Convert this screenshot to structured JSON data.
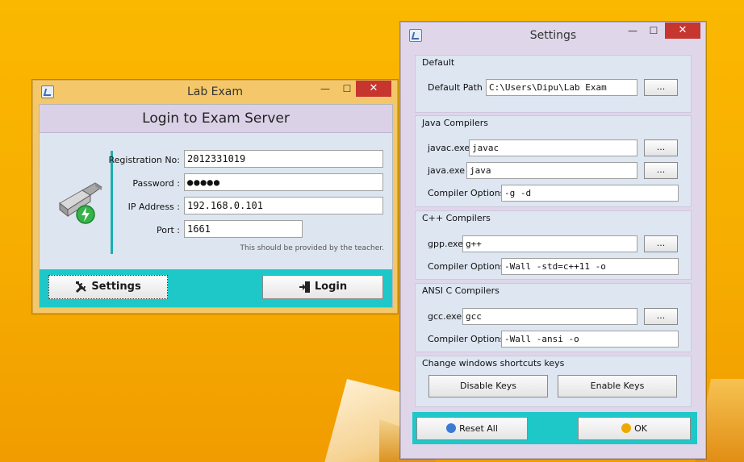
{
  "lab_window": {
    "title": "Lab Exam",
    "header": "Login to Exam Server",
    "fields": {
      "registration_label": "Registration No:",
      "registration_value": "2012331019",
      "password_label": "Password :",
      "password_value": "●●●●●",
      "ip_label": "IP Address :",
      "ip_value": "192.168.0.101",
      "port_label": "Port :",
      "port_value": "1661"
    },
    "hint": "This should be provided by the teacher.",
    "settings_label": "Settings",
    "login_label": "Login",
    "minimize": "—",
    "maximize": "☐",
    "close": "✕"
  },
  "settings_window": {
    "title": "Settings",
    "minimize": "—",
    "maximize": "☐",
    "close": "✕",
    "default": {
      "title": "Default",
      "path_label": "Default Path :",
      "path_value": "C:\\Users\\Dipu\\Lab Exam",
      "browse": "..."
    },
    "java": {
      "title": "Java Compilers",
      "javac_label": "javac.exe",
      "javac_value": "javac",
      "java_label": "java.exe",
      "java_value": "java",
      "options_label": "Compiler Options:",
      "options_value": "-g -d",
      "browse": "..."
    },
    "cpp": {
      "title": "C++ Compilers",
      "gpp_label": "gpp.exe",
      "gpp_value": "g++",
      "options_label": "Compiler Options:",
      "options_value": "-Wall -std=c++11 -o",
      "browse": "..."
    },
    "ansic": {
      "title": "ANSI C Compilers",
      "gcc_label": "gcc.exe",
      "gcc_value": "gcc",
      "options_label": "Compiler Options:",
      "options_value": "-Wall -ansi -o",
      "browse": "..."
    },
    "shortcuts": {
      "title": "Change windows shortcuts keys",
      "disable": "Disable Keys",
      "enable": "Enable Keys"
    },
    "reset_label": "Reset All",
    "ok_label": "OK"
  },
  "colors": {
    "accent_bar": "#1fc8c8",
    "close_button": "#c7352f",
    "lab_frame": "#f4c86a",
    "settings_frame": "#dfd6ea",
    "desktop": "#f7b400"
  }
}
